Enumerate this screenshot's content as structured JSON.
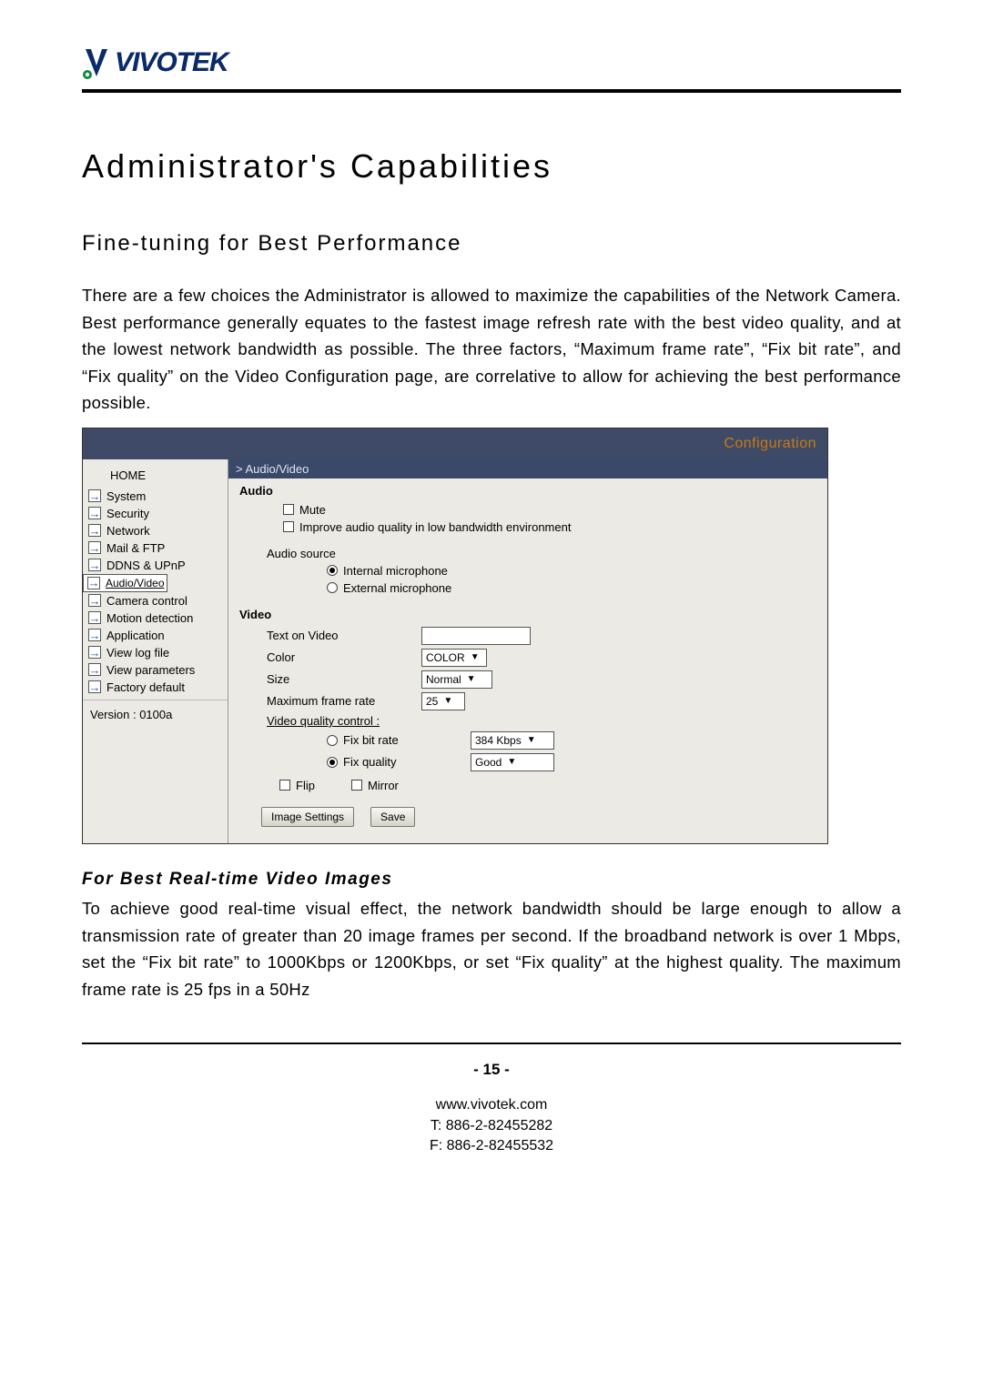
{
  "logo_text": "VIVOTEK",
  "heading": "Administrator's Capabilities",
  "subheading": "Fine-tuning for Best Performance",
  "intro_para": "There are a few choices the Administrator is allowed to maximize the capabilities of the Network Camera.  Best performance generally equates to the fastest image refresh rate with the best video quality, and at the lowest network bandwidth as possible. The three factors, “Maximum frame rate”, “Fix bit rate”, and “Fix quality” on the Video Configuration page, are correlative to allow for achieving the best performance possible.",
  "screenshot": {
    "titlebar": "Configuration",
    "sidebar": {
      "home": "HOME",
      "items": [
        {
          "label": "System"
        },
        {
          "label": "Security"
        },
        {
          "label": "Network"
        },
        {
          "label": "Mail & FTP"
        },
        {
          "label": "DDNS & UPnP"
        },
        {
          "label": "Audio/Video",
          "selected": true
        },
        {
          "label": "Camera control"
        },
        {
          "label": "Motion detection"
        },
        {
          "label": "Application"
        },
        {
          "label": "View log file"
        },
        {
          "label": "View parameters"
        },
        {
          "label": "Factory default"
        }
      ],
      "version": "Version : 0100a"
    },
    "breadcrumb": "> Audio/Video",
    "audio": {
      "title": "Audio",
      "mute": "Mute",
      "improve": "Improve audio quality in low bandwidth environment",
      "source_label": "Audio source",
      "internal": "Internal microphone",
      "external": "External microphone"
    },
    "video": {
      "title": "Video",
      "text_on_video": "Text on Video",
      "color": "Color",
      "color_val": "COLOR",
      "size": "Size",
      "size_val": "Normal",
      "max_rate": "Maximum frame rate",
      "max_rate_val": "25",
      "vqc": "Video quality control :",
      "fix_bit": "Fix bit rate",
      "fix_bit_val": "384 Kbps",
      "fix_quality": "Fix quality",
      "fix_quality_val": "Good",
      "flip": "Flip",
      "mirror": "Mirror",
      "img_settings_btn": "Image Settings",
      "save_btn": "Save"
    }
  },
  "section2_heading": "For Best Real-time Video Images",
  "section2_para": "To achieve good real-time visual effect, the network bandwidth should be large enough to allow a transmission rate of greater than 20 image frames per second. If the broadband network is over 1 Mbps, set the “Fix bit rate” to 1000Kbps or 1200Kbps, or set “Fix quality” at the highest quality. The maximum frame rate is 25 fps in a 50Hz",
  "page_number": "- 15 -",
  "footer": {
    "url": "www.vivotek.com",
    "tel": "T: 886-2-82455282",
    "fax": "F: 886-2-82455532"
  }
}
